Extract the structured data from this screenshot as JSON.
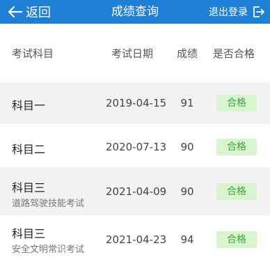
{
  "topbar": {
    "back_label": "返回",
    "title": "成绩查询",
    "logout_label": "退出登录",
    "color": "#1e7fd6"
  },
  "table": {
    "columns": [
      "考试科目",
      "考试日期",
      "成绩",
      "是否合格"
    ],
    "rows": [
      {
        "subject": "科目一",
        "note": "",
        "date": "2019-04-15",
        "score": "91",
        "status": "合格"
      },
      {
        "subject": "科目二",
        "note": "",
        "date": "2020-07-13",
        "score": "90",
        "status": "合格"
      },
      {
        "subject": "科目三",
        "note": "道路驾驶技能考试",
        "date": "2021-04-09",
        "score": "90",
        "status": "合格"
      },
      {
        "subject": "科目三",
        "note": "安全文明常识考试",
        "date": "2021-04-23",
        "score": "94",
        "status": "合格"
      }
    ],
    "badge_bg": "#d8f5cf",
    "badge_text_color": "#3aa63a"
  }
}
